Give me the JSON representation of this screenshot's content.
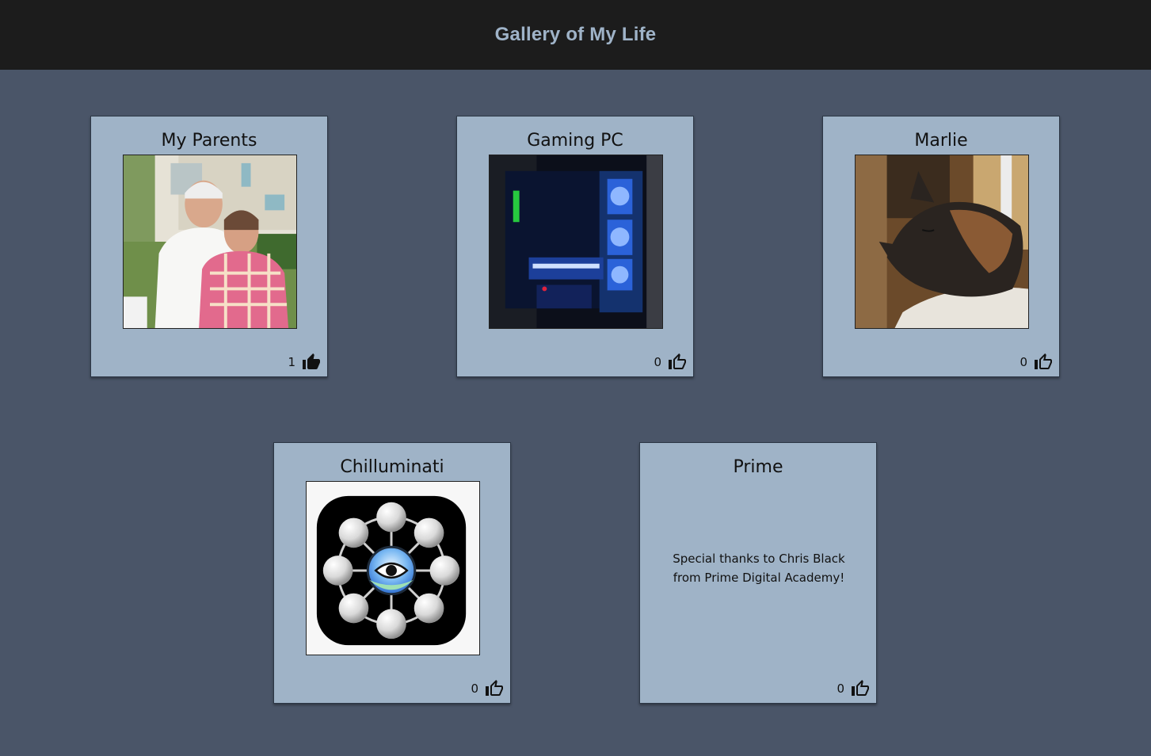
{
  "header": {
    "title": "Gallery of My Life"
  },
  "gallery": {
    "items": [
      {
        "title": "My Parents",
        "likes": "1",
        "liked": true,
        "image": "photo-parents"
      },
      {
        "title": "Gaming PC",
        "likes": "0",
        "liked": false,
        "image": "photo-gaming-pc"
      },
      {
        "title": "Marlie",
        "likes": "0",
        "liked": false,
        "image": "photo-cat"
      },
      {
        "title": "Chilluminati",
        "likes": "0",
        "liked": false,
        "image": "chilluminati-logo"
      },
      {
        "title": "Prime",
        "likes": "0",
        "liked": false,
        "description": "Special thanks to Chris Black from Prime Digital Academy!"
      }
    ]
  },
  "icons": {
    "like": "thumb-up-icon"
  },
  "colors": {
    "header_bg": "#1c1c1c",
    "header_text": "#9fb3c8",
    "page_bg": "#4a5568",
    "card_bg": "#9fb3c7"
  }
}
